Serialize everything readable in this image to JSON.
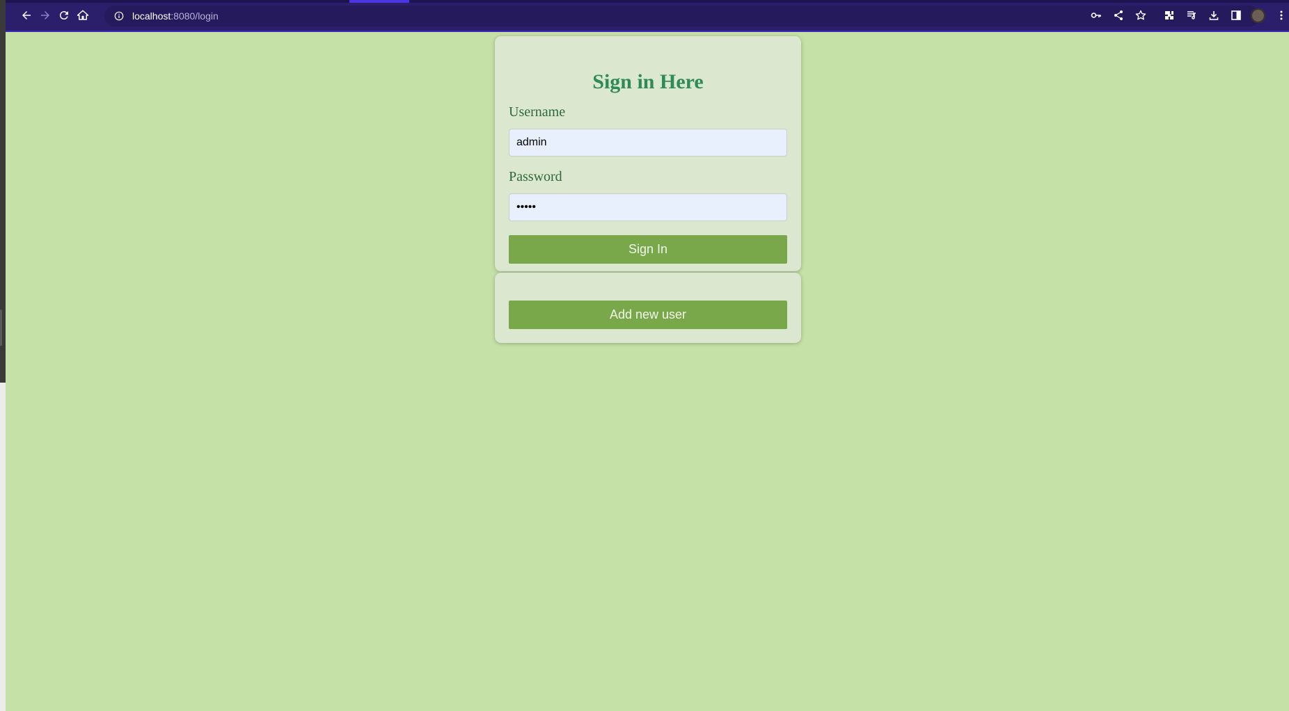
{
  "browser": {
    "url_host": "localhost",
    "url_path": ":8080/login",
    "toolbar_icons": [
      "back-icon",
      "forward-icon",
      "reload-icon",
      "home-icon",
      "info-icon",
      "key-icon",
      "share-icon",
      "star-icon",
      "extensions-icon",
      "media-icon",
      "download-icon",
      "sidepanel-icon",
      "avatar",
      "menu-icon"
    ],
    "accent_color": "#2b1f6b"
  },
  "login": {
    "title": "Sign in Here",
    "username_label": "Username",
    "username_value": "admin",
    "password_label": "Password",
    "password_value": "•••••",
    "signin_label": "Sign In"
  },
  "register": {
    "add_user_label": "Add new user"
  },
  "colors": {
    "page_background": "#c6e1a7",
    "card_background": "#dbe7cf",
    "title_color": "#2e8b57",
    "button_color": "#78a84a"
  }
}
